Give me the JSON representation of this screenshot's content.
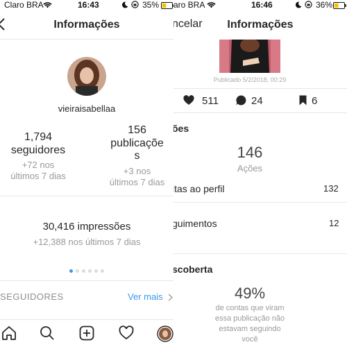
{
  "left": {
    "status": {
      "carrier": "Claro BRA",
      "time": "16:43",
      "battery": "35%"
    },
    "nav": {
      "title": "Informações",
      "back_icon": "chevron-left-icon"
    },
    "profile": {
      "username": "vieiraisabellaa"
    },
    "stats": {
      "followers_value": "1,794",
      "followers_label": "seguidores",
      "followers_delta_1": "+72 nos",
      "followers_delta_2": "últimos 7 dias",
      "posts_value": "156",
      "posts_label_1": "publicaçõe",
      "posts_label_2": "s",
      "posts_delta_1": "+3 nos",
      "posts_delta_2": "últimos 7 dias"
    },
    "impressions": {
      "value": "30,416 impressões",
      "delta": "+12,388 nos últimos 7 dias"
    },
    "pager": {
      "total": 6,
      "active": 0
    },
    "followers_section": {
      "label": "SEGUIDORES",
      "link": "Ver mais"
    },
    "tabbar": [
      "home-icon",
      "search-icon",
      "new-post-icon",
      "heart-icon",
      "profile-avatar"
    ]
  },
  "right": {
    "status": {
      "carrier": "aro BRA",
      "time": "16:46",
      "battery": "36%"
    },
    "nav": {
      "title": "Informações",
      "cancel": "ncelar"
    },
    "post": {
      "published": "Publicado 5/2/2018, 00:29"
    },
    "engagement": {
      "likes": "511",
      "comments": "24",
      "saves": "6"
    },
    "actions": {
      "heading": "ões",
      "value": "146",
      "label": "Ações",
      "rows": [
        {
          "label": "itas ao perfil",
          "value": "132"
        },
        {
          "label": "guimentos",
          "value": "12"
        }
      ]
    },
    "discovery": {
      "heading": "scoberta",
      "percent": "49%",
      "desc_1": "de contas que viram",
      "desc_2": "essa publicação não",
      "desc_3": "estavam seguindo",
      "desc_4": "você"
    }
  },
  "colors": {
    "accent": "#3897f0",
    "battery_fill": "#f5c400",
    "divider": "#e6e6e6",
    "muted": "#999999"
  }
}
